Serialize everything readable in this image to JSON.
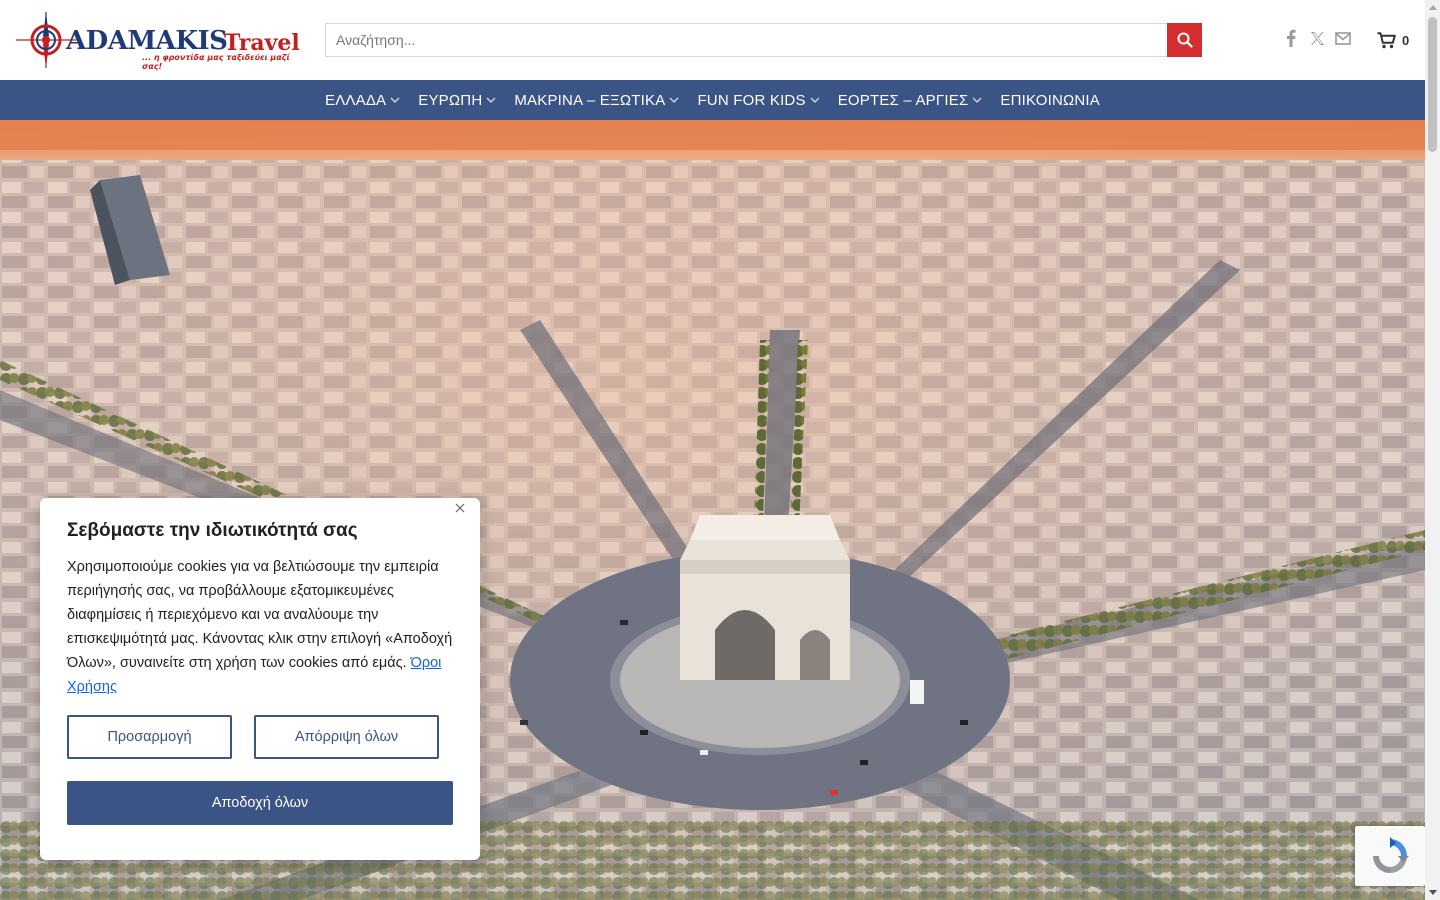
{
  "header": {
    "logo": {
      "brand": "ADAMAKIS",
      "travel": "Travel",
      "tagline": "... η φροντίδα μας ταξιδεύει μαζί σας!"
    },
    "search": {
      "placeholder": "Αναζήτηση...",
      "value": ""
    },
    "social": [
      "facebook-icon",
      "x-icon",
      "email-icon"
    ],
    "cart": {
      "count": "0"
    }
  },
  "nav": {
    "items": [
      {
        "label": "ΕΛΛΑΔΑ",
        "has_dropdown": true
      },
      {
        "label": "ΕΥΡΩΠΗ",
        "has_dropdown": true
      },
      {
        "label": "ΜΑΚΡΙΝΑ – ΕΞΩΤΙΚΑ",
        "has_dropdown": true
      },
      {
        "label": "FUN FOR KIDS",
        "has_dropdown": true
      },
      {
        "label": "ΕΟΡΤΕΣ – ΑΡΓΙΕΣ",
        "has_dropdown": true
      },
      {
        "label": "ΕΠΙΚΟΙΝΩΝΙΑ",
        "has_dropdown": false
      }
    ]
  },
  "cookie_banner": {
    "title": "Σεβόμαστε την ιδιωτικότητά σας",
    "body": "Χρησιμοποιούμε cookies για να βελτιώσουμε την εμπειρία περιήγησής σας, να προβάλλουμε εξατομικευμένες διαφημίσεις ή περιεχόμενο και να αναλύουμε την επισκεψιμότητά μας. Κάνοντας κλικ στην επιλογή «Αποδοχή Όλων», συναινείτε στη χρήση των cookies από εμάς.",
    "link": "Όροι Χρήσης",
    "customize": "Προσαρμογή",
    "reject_all": "Απόρριψη όλων",
    "accept_all": "Αποδοχή όλων"
  },
  "colors": {
    "nav_bg": "#3b5486",
    "search_button": "#d42e2e",
    "brand_blue": "#1f3a77",
    "brand_red": "#c51f1f",
    "link": "#1863dc"
  }
}
